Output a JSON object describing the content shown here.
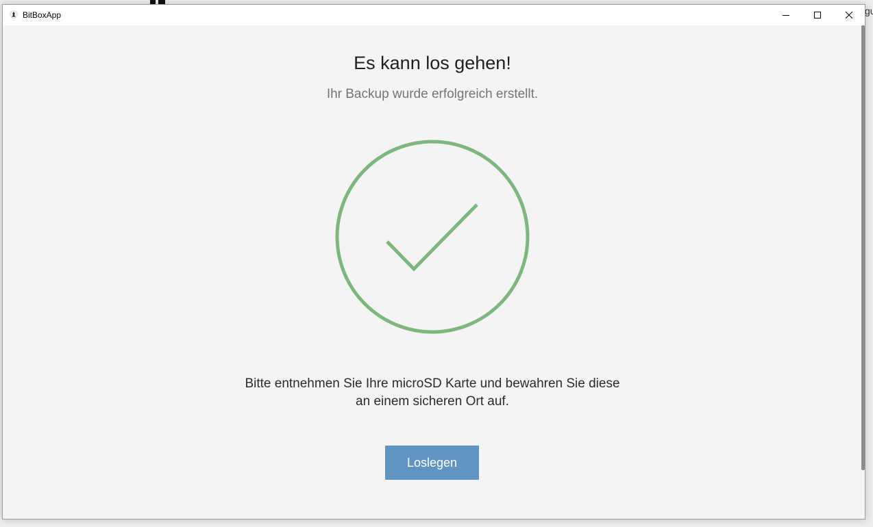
{
  "window": {
    "title": "BitBoxApp",
    "controls": {
      "minimize_icon": "minimize-icon",
      "maximize_icon": "maximize-icon",
      "close_icon": "close-icon"
    }
  },
  "desktop": {
    "edge_text": "gu"
  },
  "main": {
    "title": "Es kann los gehen!",
    "subtitle": "Ihr Backup wurde erfolgreich erstellt.",
    "status_icon": "checkmark-circle-icon",
    "message_line_1": "Bitte entnehmen Sie Ihre microSD Karte und bewahren Sie diese",
    "message_line_2": "an einem sicheren Ort auf.",
    "continue_label": "Loslegen"
  },
  "colors": {
    "success": "#7cb87c",
    "primary_button": "#5f94c3",
    "background": "#f4f4f4"
  }
}
